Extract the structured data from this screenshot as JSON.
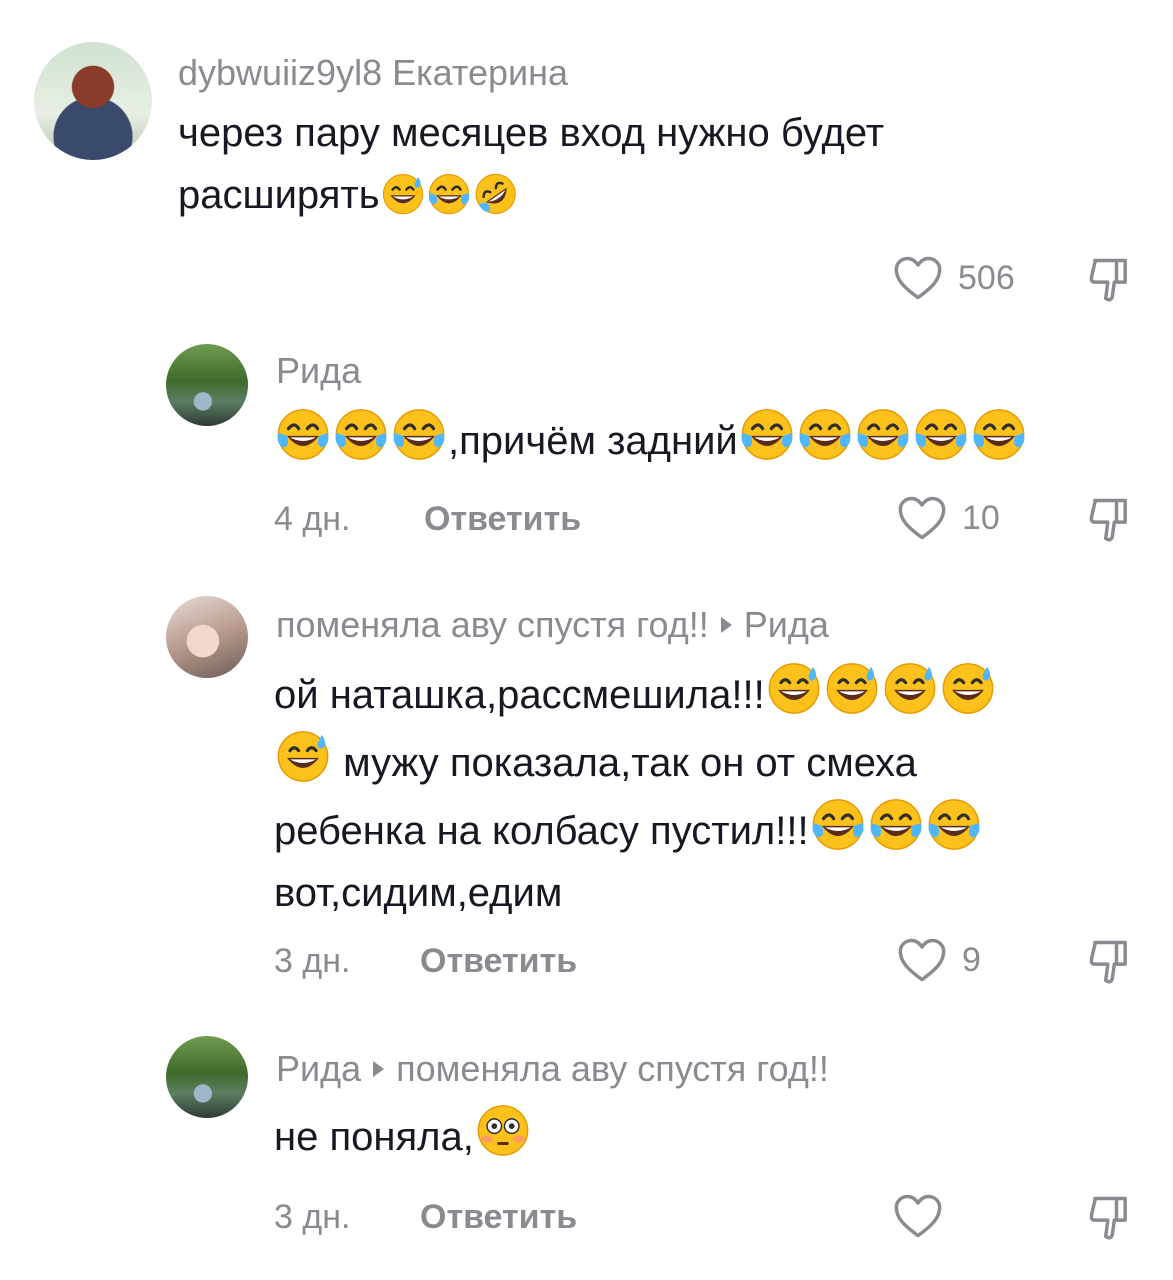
{
  "comments": [
    {
      "username": "dybwuiiz9yl8 Екатерина",
      "text_line1": "через пару месяцев вход нужно будет",
      "text_line2": "расширять",
      "likes": "506"
    },
    {
      "username": "Рида",
      "text": ",причём задний",
      "time": "4 дн.",
      "reply_label": "Ответить",
      "likes": "10"
    },
    {
      "username": "поменяла аву спустя год!!",
      "reply_to": "Рида",
      "text_line1": "ой наташка,рассмешила!!!",
      "text_line2": "мужу показала,так он от смеха",
      "text_line3": "ребенка на колбасу пустил!!!",
      "text_line4": "вот,сидим,едим",
      "time": "3 дн.",
      "reply_label": "Ответить",
      "likes": "9"
    },
    {
      "username": "Рида",
      "reply_to": "поменяла аву спустя год!!",
      "text": "не поняла,",
      "time": "3 дн.",
      "reply_label": "Ответить"
    }
  ],
  "icons": {
    "like": "heart-outline-icon",
    "dislike": "thumbs-down-outline-icon",
    "emoji_sweat": "grinning-sweat-emoji",
    "emoji_joy": "tears-of-joy-emoji",
    "emoji_rofl": "rolling-laughing-emoji",
    "emoji_flushed": "flushed-emoji"
  }
}
